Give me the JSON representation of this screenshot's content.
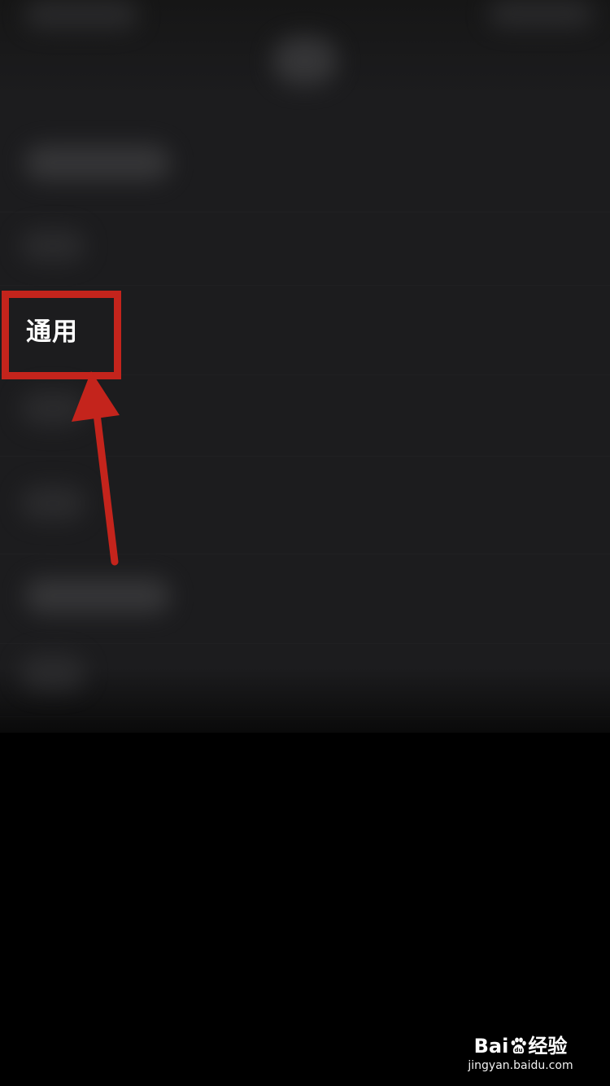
{
  "settings": {
    "items": [
      {
        "label": "通用"
      }
    ]
  },
  "annotation": {
    "box_color": "#c4241c",
    "arrow_color": "#c4241c"
  },
  "watermark": {
    "brand_prefix": "Bai",
    "brand_suffix": "经验",
    "url": "jingyan.baidu.com",
    "icon": "baidu-paw-icon"
  },
  "colors": {
    "panel_background": "#1c1c1e",
    "screen_background": "#000000",
    "text": "#ffffff"
  }
}
